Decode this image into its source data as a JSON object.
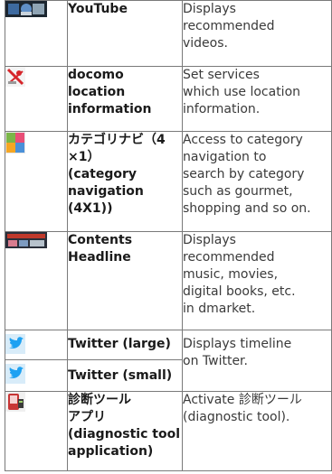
{
  "rows": [
    {
      "icon": "youtube-thumbnail-icon",
      "name": "YouTube",
      "description": "Displays\nrecommended\nvideos."
    },
    {
      "icon": "docomo-location-icon",
      "name": "docomo\nlocation\ninformation",
      "description": "Set services\nwhich use location\ninformation."
    },
    {
      "icon": "category-navi-icon",
      "name": "カテゴリナビ（4\n×1）\n(category\nnavigation\n(4X1))",
      "description": "Access to category\nnavigation to\nsearch by category\nsuch as gourmet,\nshopping and so on."
    },
    {
      "icon": "contents-headline-icon",
      "name": "Contents\nHeadline",
      "description": "Displays\nrecommended\nmusic, movies,\ndigital books, etc.\nin dmarket."
    },
    {
      "icon": "twitter-bird-icon",
      "name": "Twitter (large)",
      "description": "Displays timeline\non Twitter."
    },
    {
      "icon": "twitter-bird-icon",
      "name": "Twitter (small)"
    },
    {
      "icon": "diagnostic-tool-icon",
      "name": "診断ツール\nアプリ\n(diagnostic tool\napplication)",
      "description": "Activate 診断ツール\n(diagnostic tool)."
    }
  ],
  "colors": {
    "border": "#7a7a7a",
    "twitter_blue": "#1da1f2",
    "location_red": "#d6262b"
  }
}
